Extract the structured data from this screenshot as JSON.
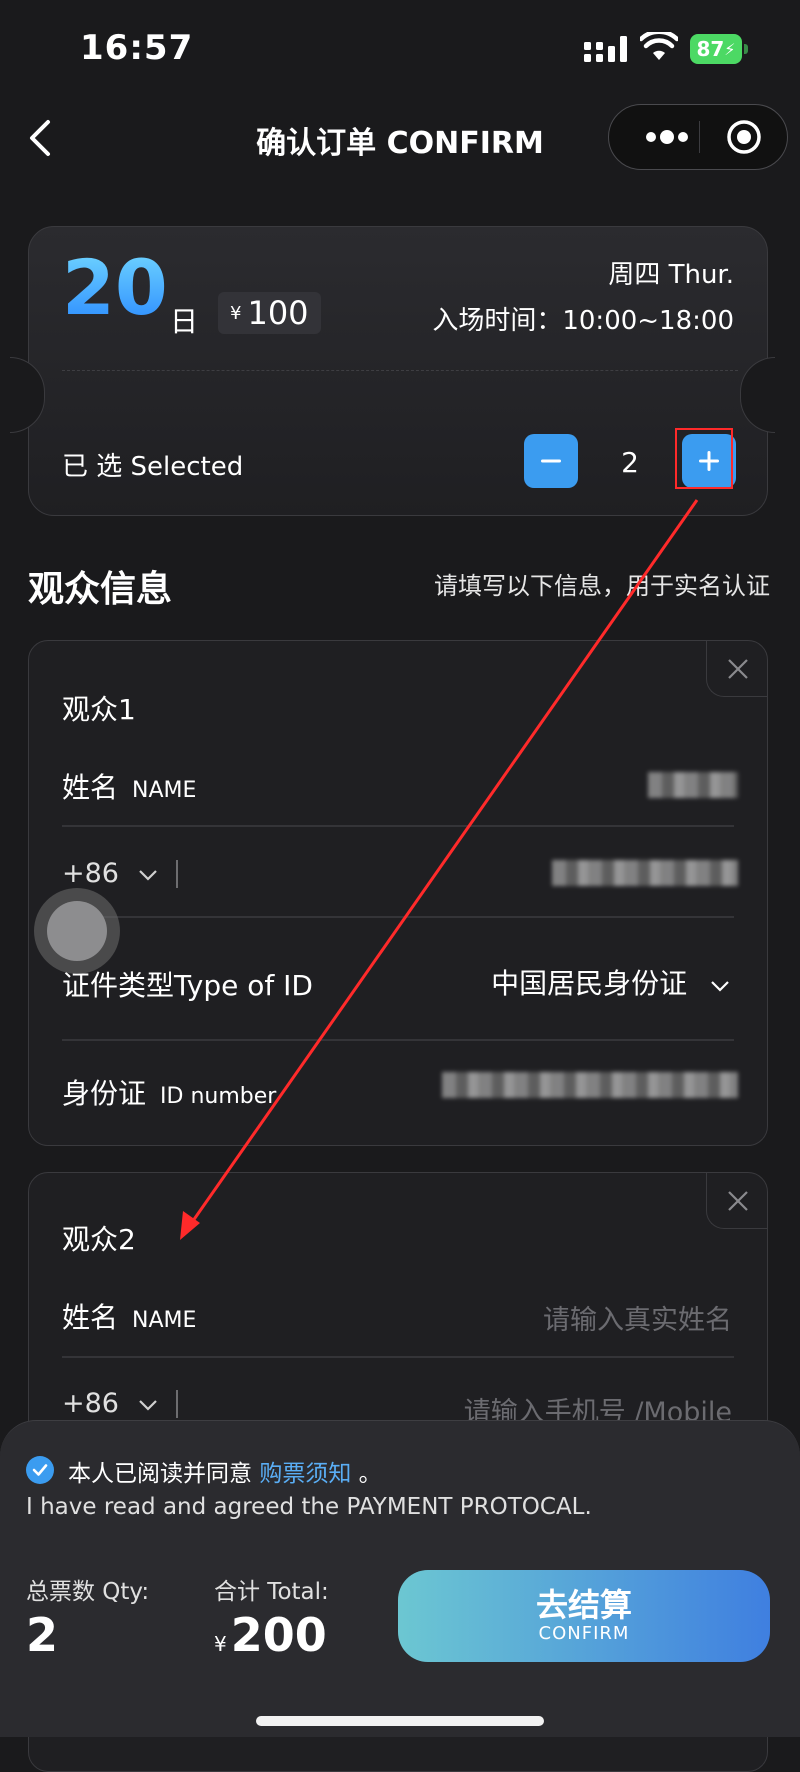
{
  "status": {
    "time": "16:57",
    "battery": "87"
  },
  "nav": {
    "title": "确认订单 CONFIRM"
  },
  "ticket": {
    "day": "20",
    "day_unit": "日",
    "currency": "¥",
    "price": "100",
    "weekday": "周四 Thur.",
    "entry_time": "入场时间：10:00~18:00",
    "selected_label": "已 选 Selected",
    "quantity": "2"
  },
  "audience": {
    "title": "观众信息",
    "hint": "请填写以下信息，用于实名认证",
    "cards": [
      {
        "title": "观众1",
        "name_label": "姓名",
        "name_label_en": "NAME",
        "country_code": "+86",
        "id_type_label": "证件类型Type of ID",
        "id_type_value": "中国居民身份证",
        "id_label": "身份证",
        "id_label_en": "ID number"
      },
      {
        "title": "观众2",
        "name_label": "姓名",
        "name_label_en": "NAME",
        "name_placeholder": "请输入真实姓名",
        "country_code": "+86",
        "mobile_placeholder": "请输入手机号 /Mobile"
      }
    ]
  },
  "footer": {
    "agree_text": "本人已阅读并同意",
    "agree_link": "购票须知",
    "agree_end": "。",
    "agree_en": "I have read and agreed the PAYMENT PROTOCAL.",
    "qty_label": "总票数 Qty:",
    "qty_value": "2",
    "total_label": "合计 Total:",
    "currency": "¥",
    "total_value": "200",
    "confirm_zh": "去结算",
    "confirm_en": "CONFIRM"
  },
  "colors": {
    "accent": "#3b9cf0",
    "annotation": "#ff2a2a"
  }
}
